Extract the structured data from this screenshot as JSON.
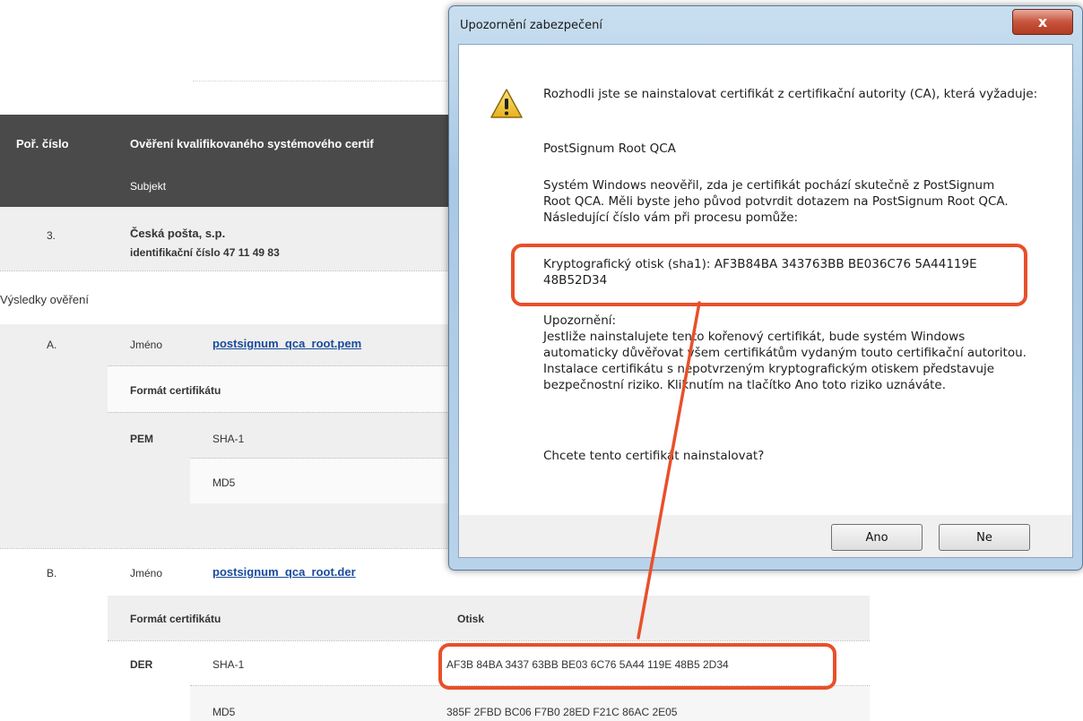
{
  "page": {
    "table_header": {
      "col1": "Poř. číslo",
      "col2": "Ověření kvalifikovaného systémového certif",
      "col2_sub": "Subjekt"
    },
    "row": {
      "number": "3.",
      "subject_name": "Česká pošta, s.p.",
      "subject_id": "identifikační číslo 47 11 49 83"
    },
    "results_title": "Výsledky ověření",
    "item_a": {
      "letter": "A.",
      "name_label": "Jméno",
      "file": "postsignum_qca_root.pem",
      "format_label": "Formát certifikátu",
      "format": "PEM",
      "sha": "SHA-1",
      "md5": "MD5"
    },
    "item_b": {
      "letter": "B.",
      "name_label": "Jméno",
      "file": "postsignum_qca_root.der",
      "format_label": "Formát certifikátu",
      "hash_label": "Otisk",
      "format": "DER",
      "sha": "SHA-1",
      "sha_value": "AF3B 84BA 3437 63BB BE03 6C76 5A44 119E 48B5 2D34",
      "md5": "MD5",
      "md5_value": "385F 2FBD BC06 F7B0 28ED F21C 86AC 2E05"
    }
  },
  "dialog": {
    "title": "Upozornění zabezpečení",
    "close_glyph": "x",
    "icon": "warning-icon",
    "p1": "Rozhodli jste se nainstalovat certifikát z certifikační autority (CA), která vyžaduje:",
    "ca_name": "PostSignum Root QCA",
    "p2": "Systém Windows neověřil, zda je certifikát pochází skutečně z PostSignum Root QCA. Měli byste jeho původ potvrdit dotazem na PostSignum Root QCA. Následující číslo vám při procesu pomůže:",
    "thumb_line1": "Kryptografický otisk (sha1): AF3B84BA 343763BB BE036C76 5A44119E",
    "thumb_line2": "48B52D34",
    "warn_title": "Upozornění:",
    "warn_text": "Jestliže nainstalujete tento kořenový certifikát, bude systém Windows automaticky důvěřovat všem certifikátům vydaným touto certifikační autoritou. Instalace certifikátu s nepotvrzeným kryptografickým otiskem představuje bezpečnostní riziko. Kliknutím na tlačítko Ano toto riziko uznáváte.",
    "question": "Chcete tento certifikát nainstalovat?",
    "yes": "Ano",
    "no": "Ne"
  },
  "colors": {
    "highlight": "#e8502a",
    "header_bg": "#4a4a4a",
    "link": "#1a4a9c"
  }
}
